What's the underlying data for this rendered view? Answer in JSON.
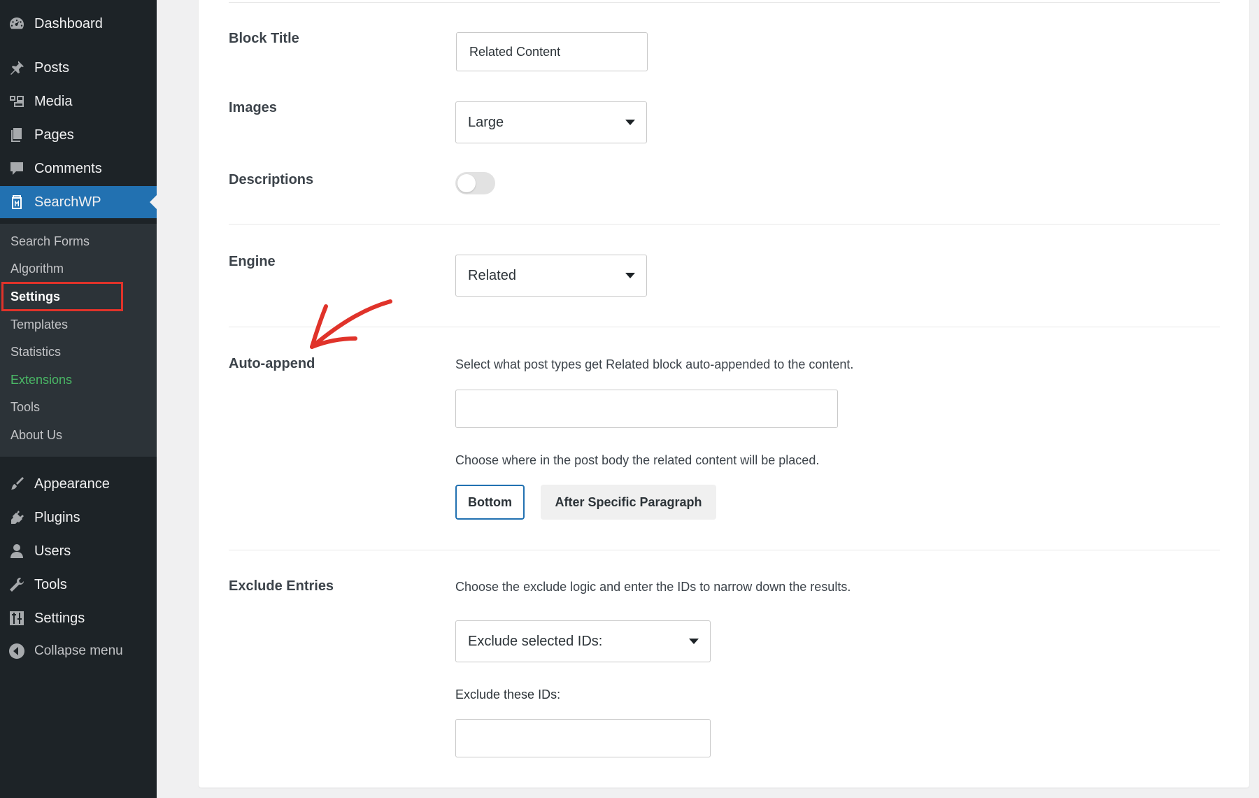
{
  "sidebar": {
    "top_items": [
      {
        "label": "Dashboard",
        "icon": "dashboard-icon"
      },
      {
        "label": "Posts",
        "icon": "pin-icon"
      },
      {
        "label": "Media",
        "icon": "media-icon"
      },
      {
        "label": "Pages",
        "icon": "pages-icon"
      },
      {
        "label": "Comments",
        "icon": "comments-icon"
      },
      {
        "label": "SearchWP",
        "icon": "searchwp-icon"
      }
    ],
    "submenu": [
      "Search Forms",
      "Algorithm",
      "Settings",
      "Templates",
      "Statistics",
      "Extensions",
      "Tools",
      "About Us"
    ],
    "bottom_items": [
      {
        "label": "Appearance",
        "icon": "brush-icon"
      },
      {
        "label": "Plugins",
        "icon": "plug-icon"
      },
      {
        "label": "Users",
        "icon": "user-icon"
      },
      {
        "label": "Tools",
        "icon": "wrench-icon"
      },
      {
        "label": "Settings",
        "icon": "sliders-icon"
      }
    ],
    "collapse_label": "Collapse menu",
    "accent_color": "#2271b1",
    "highlight_color": "#e0332a",
    "extensions_color": "#4ab866"
  },
  "form": {
    "block_title": {
      "label": "Block Title",
      "value": "Related Content"
    },
    "images": {
      "label": "Images",
      "selected": "Large"
    },
    "descriptions": {
      "label": "Descriptions",
      "enabled": false
    },
    "engine": {
      "label": "Engine",
      "selected": "Related"
    },
    "auto_append": {
      "label": "Auto-append",
      "description": "Select what post types get Related block auto-appended to the content.",
      "post_types_value": "",
      "placement_description": "Choose where in the post body the related content will be placed.",
      "options": [
        "Bottom",
        "After Specific Paragraph"
      ],
      "selected": "Bottom"
    },
    "exclude": {
      "label": "Exclude Entries",
      "description": "Choose the exclude logic and enter the IDs to narrow down the results.",
      "logic_selected": "Exclude selected IDs:",
      "ids_label": "Exclude these IDs:",
      "ids_value": ""
    }
  }
}
